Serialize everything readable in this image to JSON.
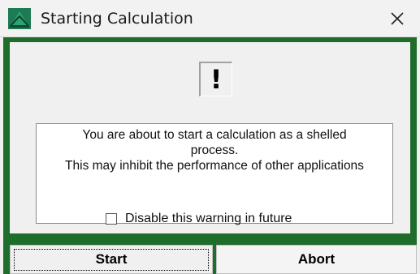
{
  "window": {
    "title": "Starting Calculation",
    "icons": {
      "app": "app-icon",
      "close": "close-icon"
    }
  },
  "dialog": {
    "icon_symbol": "!",
    "message_lines": [
      "You are about to start a calculation as a shelled",
      "process.",
      "This may inhibit the performance of other applications"
    ],
    "checkbox": {
      "label": "Disable this warning in future",
      "checked": false
    },
    "buttons": {
      "start": "Start",
      "abort": "Abort"
    }
  },
  "colors": {
    "frame_green": "#1f6d2a",
    "background": "#f0f0f0"
  }
}
